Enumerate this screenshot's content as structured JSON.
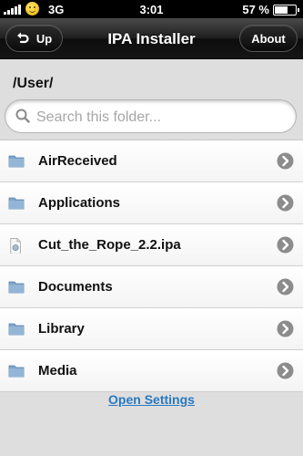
{
  "status_bar": {
    "network": "3G",
    "time": "3:01",
    "battery": "57 %",
    "icons": [
      "signal-icon",
      "smiley-icon",
      "battery-icon"
    ]
  },
  "nav": {
    "title": "IPA Installer",
    "up_label": "Up",
    "about_label": "About",
    "up_icon": "undo-arrow-icon"
  },
  "content": {
    "path": "/User/",
    "search": {
      "placeholder": "Search this folder...",
      "value": ""
    },
    "items": [
      {
        "label": "AirReceived",
        "icon": "folder-icon"
      },
      {
        "label": "Applications",
        "icon": "folder-icon"
      },
      {
        "label": "Cut_the_Rope_2.2.ipa",
        "icon": "ipa-file-icon"
      },
      {
        "label": "Documents",
        "icon": "folder-icon"
      },
      {
        "label": "Library",
        "icon": "folder-icon"
      },
      {
        "label": "Media",
        "icon": "folder-icon"
      }
    ],
    "footer_link": "Open Settings"
  },
  "colors": {
    "nav_bar": "#151515",
    "link": "#2a78c2",
    "folder": "#7fa4c8",
    "background": "#dedede"
  }
}
